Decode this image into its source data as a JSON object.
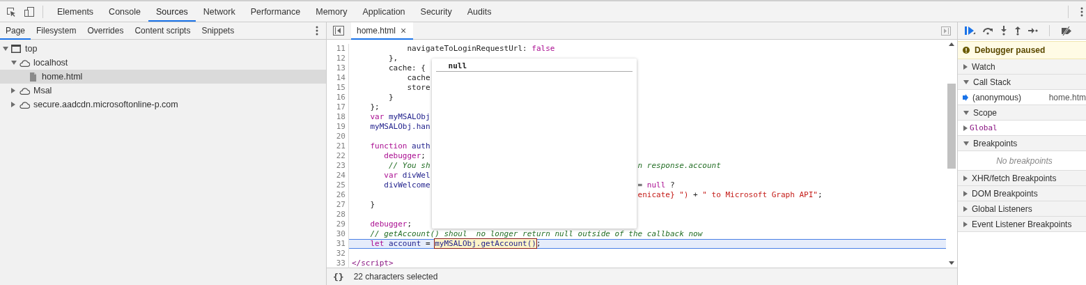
{
  "main_tabs": [
    {
      "label": "Elements",
      "selected": false
    },
    {
      "label": "Console",
      "selected": false
    },
    {
      "label": "Sources",
      "selected": true
    },
    {
      "label": "Network",
      "selected": false
    },
    {
      "label": "Performance",
      "selected": false
    },
    {
      "label": "Memory",
      "selected": false
    },
    {
      "label": "Application",
      "selected": false
    },
    {
      "label": "Security",
      "selected": false
    },
    {
      "label": "Audits",
      "selected": false
    }
  ],
  "navigator": {
    "tabs": [
      {
        "label": "Page",
        "selected": true
      },
      {
        "label": "Filesystem",
        "selected": false
      },
      {
        "label": "Overrides",
        "selected": false
      },
      {
        "label": "Content scripts",
        "selected": false
      },
      {
        "label": "Snippets",
        "selected": false
      }
    ],
    "tree": [
      {
        "label": "top",
        "kind": "frame",
        "expanded": true,
        "selected": false,
        "children": [
          {
            "label": "localhost",
            "kind": "domain",
            "expanded": true,
            "selected": false,
            "children": [
              {
                "label": "home.html",
                "kind": "file",
                "selected": true
              }
            ]
          },
          {
            "label": "Msal",
            "kind": "domain",
            "expanded": false,
            "selected": false
          },
          {
            "label": "secure.aadcdn.microsoftonline-p.com",
            "kind": "domain",
            "expanded": false,
            "selected": false
          }
        ]
      }
    ]
  },
  "editor": {
    "tabs": [
      {
        "label": "home.html",
        "close": "×",
        "selected": true
      }
    ],
    "lines": [
      {
        "number": "11",
        "current": false,
        "segments": [
          {
            "text": "            navigateToLoginRequestUrl: ",
            "kind": "plain"
          },
          {
            "text": "false",
            "kind": "keyword"
          }
        ]
      },
      {
        "number": "12",
        "current": false,
        "segments": [
          {
            "text": "        },",
            "kind": "plain"
          }
        ]
      },
      {
        "number": "13",
        "current": false,
        "segments": [
          {
            "text": "        cache: {",
            "kind": "plain"
          }
        ]
      },
      {
        "number": "14",
        "current": false,
        "segments": [
          {
            "text": "            cache",
            "kind": "plain"
          }
        ]
      },
      {
        "number": "15",
        "current": false,
        "segments": [
          {
            "text": "            store",
            "kind": "plain"
          }
        ]
      },
      {
        "number": "16",
        "current": false,
        "segments": [
          {
            "text": "        }",
            "kind": "plain"
          }
        ]
      },
      {
        "number": "17",
        "current": false,
        "segments": [
          {
            "text": "    };",
            "kind": "plain"
          }
        ]
      },
      {
        "number": "18",
        "current": false,
        "segments": [
          {
            "text": "    var ",
            "kind": "keyword"
          },
          {
            "text": "myMSALObj",
            "kind": "variable"
          }
        ]
      },
      {
        "number": "19",
        "current": false,
        "segments": [
          {
            "text": "    myMSALObj.han",
            "kind": "variable"
          }
        ]
      },
      {
        "number": "20",
        "current": false
      },
      {
        "number": "21",
        "current": false,
        "segments": [
          {
            "text": "    function ",
            "kind": "keyword"
          },
          {
            "text": "auth",
            "kind": "variable"
          }
        ]
      },
      {
        "number": "22",
        "current": false,
        "segments": [
          {
            "text": "       debugger",
            "kind": "keyword"
          },
          {
            "text": ";",
            "kind": "plain"
          }
        ]
      },
      {
        "number": "23",
        "current": false,
        "segments": [
          {
            "text": "        // You sh",
            "kind": "comment"
          }
        ],
        "after_popover": [
          {
            "text": "n response.account",
            "kind": "comment"
          }
        ]
      },
      {
        "number": "24",
        "current": false,
        "segments": [
          {
            "text": "       var ",
            "kind": "keyword"
          },
          {
            "text": "divWel",
            "kind": "variable"
          }
        ]
      },
      {
        "number": "25",
        "current": false,
        "segments": [
          {
            "text": "       divWelcome",
            "kind": "variable"
          }
        ],
        "after_popover": [
          {
            "text": "= ",
            "kind": "plain"
          },
          {
            "text": "null",
            "kind": "keyword"
          },
          {
            "text": " ?",
            "kind": "plain"
          }
        ]
      },
      {
        "number": "26",
        "current": false,
        "after_popover": [
          {
            "text": "enicate} \")",
            "kind": "string"
          },
          {
            "text": " + ",
            "kind": "plain"
          },
          {
            "text": "\" to Microsoft Graph API\"",
            "kind": "string"
          },
          {
            "text": ";",
            "kind": "plain"
          }
        ]
      },
      {
        "number": "27",
        "current": false,
        "segments": [
          {
            "text": "    }",
            "kind": "plain"
          }
        ]
      },
      {
        "number": "28",
        "current": false
      },
      {
        "number": "29",
        "current": false,
        "segments": [
          {
            "text": "    debugger",
            "kind": "keyword"
          },
          {
            "text": ";",
            "kind": "plain"
          }
        ]
      },
      {
        "number": "30",
        "current": false,
        "segments": [
          {
            "text": "    // getAccount() shoul",
            "kind": "comment"
          },
          {
            "text": "  no longer return null outside of the callback now",
            "kind": "comment"
          }
        ]
      },
      {
        "number": "31",
        "current": true,
        "segments": [
          {
            "text": "    let ",
            "kind": "keyword"
          },
          {
            "text": "account",
            "kind": "variable"
          },
          {
            "text": " = ",
            "kind": "plain"
          },
          {
            "text": "myMSALObj.getAccount()",
            "kind": "highlight"
          },
          {
            "text": ";",
            "kind": "plain"
          }
        ]
      },
      {
        "number": "32",
        "current": false
      },
      {
        "number": "33",
        "current": false,
        "segments": [
          {
            "text": "</script>",
            "kind": "tag"
          }
        ]
      }
    ],
    "popover": {
      "value": "null"
    },
    "status": {
      "pretty_print": "{}",
      "text": "22 characters selected"
    }
  },
  "debugger": {
    "banner": "Debugger paused",
    "sections": [
      {
        "title": "Watch",
        "expanded": false
      },
      {
        "title": "Call Stack",
        "expanded": true,
        "rows": [
          {
            "kind": "frame",
            "name": "(anonymous)",
            "location": "home.htm"
          }
        ]
      },
      {
        "title": "Scope",
        "expanded": true,
        "rows": [
          {
            "kind": "scope",
            "name": "Global",
            "expanded": false
          }
        ]
      },
      {
        "title": "Breakpoints",
        "expanded": true,
        "rows": [
          {
            "kind": "empty",
            "name": "No breakpoints"
          }
        ]
      },
      {
        "title": "XHR/fetch Breakpoints",
        "expanded": false
      },
      {
        "title": "DOM Breakpoints",
        "expanded": false
      },
      {
        "title": "Global Listeners",
        "expanded": false
      },
      {
        "title": "Event Listener Breakpoints",
        "expanded": false
      }
    ]
  }
}
